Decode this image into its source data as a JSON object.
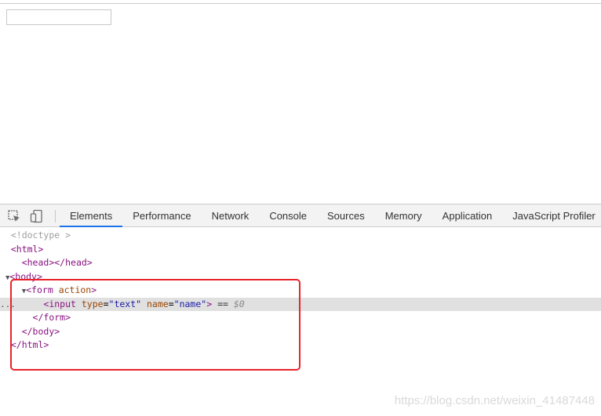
{
  "page": {
    "input_value": ""
  },
  "devtools": {
    "tabs": [
      "Elements",
      "Performance",
      "Network",
      "Console",
      "Sources",
      "Memory",
      "Application",
      "JavaScript Profiler"
    ],
    "active_tab": "Elements"
  },
  "dom_tree": {
    "doctype": "<!doctype >",
    "html_open": "<html>",
    "head": "<head></head>",
    "body_open": "<body>",
    "form_open_tag": "<form",
    "form_attr": "action",
    "form_close_bracket": ">",
    "input_open": "<input",
    "input_type_name": "type",
    "input_type_value": "\"text\"",
    "input_name_name": "name",
    "input_name_value": "\"name\"",
    "input_close": ">",
    "selected_marker": "==",
    "selected_var": "$0",
    "form_close": "</form>",
    "body_close": "</body>",
    "html_close": "</html>",
    "ellipsis": "..."
  },
  "colors": {
    "highlight_border": "#e8232a",
    "active_tab_underline": "#1a73e8"
  },
  "watermark": "https://blog.csdn.net/weixin_41487448"
}
